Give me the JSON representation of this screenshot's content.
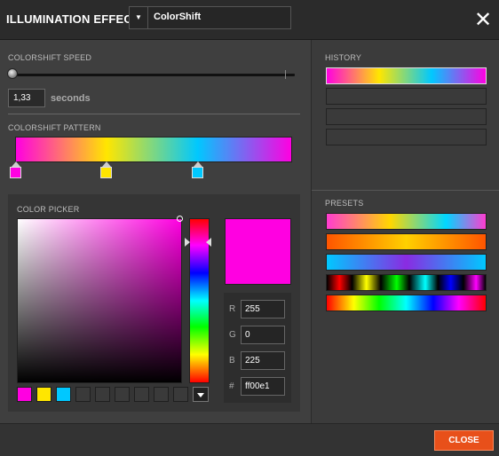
{
  "header": {
    "title": "ILLUMINATION EFFECT",
    "effect_value": "ColorShift",
    "dropdown_icon": "chevron-down-icon",
    "close_icon": "close-icon"
  },
  "speed": {
    "label": "COLORSHIFT SPEED",
    "value": "1,33",
    "unit": "seconds",
    "slider_fraction": 0.0
  },
  "pattern": {
    "label": "COLORSHIFT PATTERN",
    "stops": [
      {
        "color": "#ff00e1"
      },
      {
        "color": "#ffe600"
      },
      {
        "color": "#00c8ff"
      }
    ]
  },
  "picker": {
    "label": "COLOR PICKER",
    "r_label": "R",
    "r": "255",
    "g_label": "G",
    "g": "0",
    "b_label": "B",
    "b": "225",
    "hex_label": "#",
    "hex": "ff00e1",
    "swatches": [
      "#ff00e1",
      "#ffe600",
      "#00c8ff",
      "#3a3a3a",
      "#3a3a3a",
      "#3a3a3a",
      "#3a3a3a",
      "#3a3a3a",
      "#3a3a3a"
    ]
  },
  "history": {
    "label": "HISTORY",
    "count": 4
  },
  "presets": {
    "label": "PRESETS",
    "count": 5
  },
  "footer": {
    "close_label": "CLOSE"
  },
  "colors": {
    "accent": "#e8501a",
    "selected": "#ff00e1"
  }
}
